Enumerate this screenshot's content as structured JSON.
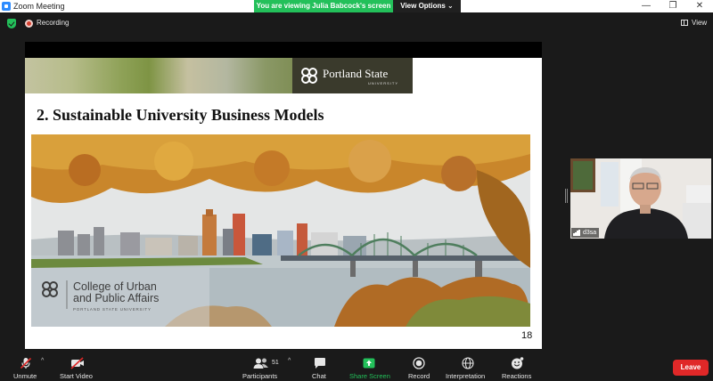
{
  "window": {
    "title": "Zoom Meeting",
    "minimize_glyph": "—",
    "restore_glyph": "❐",
    "close_glyph": "✕"
  },
  "banner": {
    "viewing_text": "You are viewing Julia Babcock's screen",
    "options_label": "View Options ⌄",
    "viewing_color": "#23c05a"
  },
  "topbar": {
    "recording_label": "Recording",
    "view_label": "View",
    "recording_color": "#d6402f"
  },
  "slide": {
    "logo_name": "Portland State",
    "logo_sub": "UNIVERSITY",
    "title": "2.  Sustainable University Business Models",
    "college_line1": "College of Urban",
    "college_line2": "and Public Affairs",
    "college_sub": "PORTLAND STATE UNIVERSITY",
    "page_number": "18"
  },
  "participant": {
    "name": "d3sa"
  },
  "toolbar": {
    "unmute_label": "Unmute",
    "start_video_label": "Start Video",
    "participants_label": "Participants",
    "participants_count": "51",
    "chat_label": "Chat",
    "share_label": "Share Screen",
    "record_label": "Record",
    "interpretation_label": "Interpretation",
    "reactions_label": "Reactions",
    "leave_label": "Leave",
    "caret_glyph": "^",
    "share_color": "#23c05a",
    "leave_color": "#e02828"
  },
  "icons": [
    "shield-icon",
    "recording-icon",
    "grid-view-icon",
    "muted-microphone-icon",
    "video-off-icon",
    "participants-icon",
    "chat-icon",
    "share-screen-icon",
    "record-icon",
    "globe-icon",
    "reactions-icon",
    "signal-icon"
  ]
}
